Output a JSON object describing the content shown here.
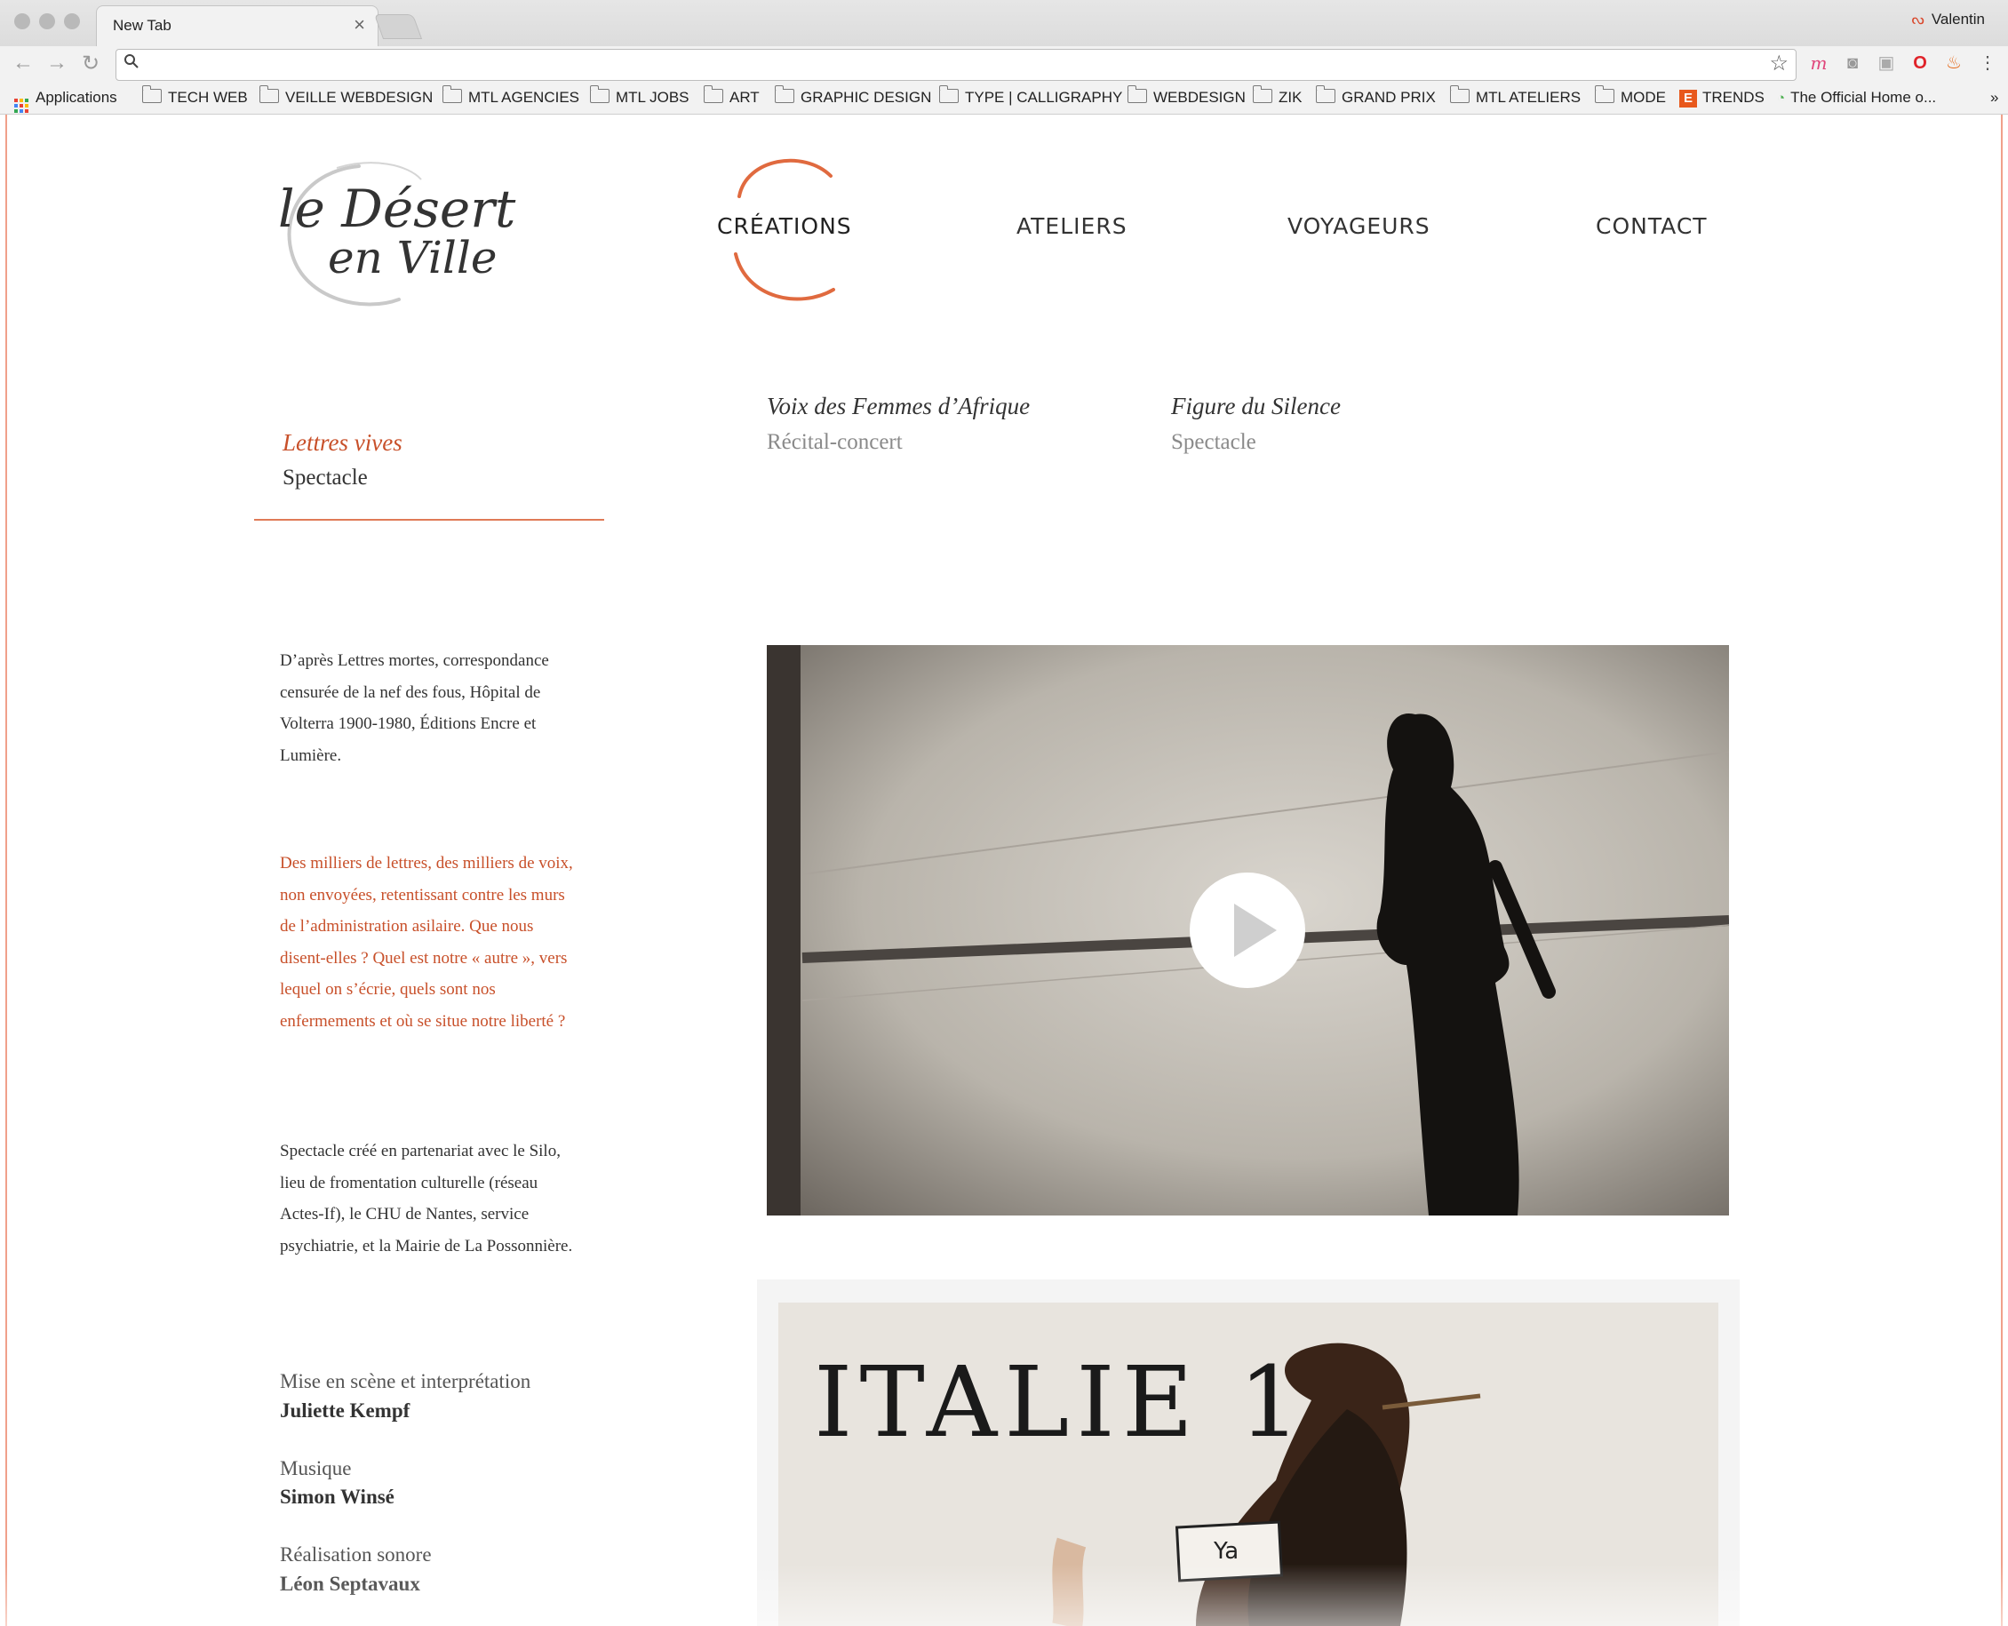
{
  "browser": {
    "tab_title": "New Tab",
    "tab_close": "×",
    "profile_name": "Valentin",
    "address_value": "",
    "bookmarks": [
      "Applications",
      "TECH WEB",
      "VEILLE WEBDESIGN",
      "MTL AGENCIES",
      "MTL JOBS",
      "ART",
      "GRAPHIC DESIGN",
      "TYPE | CALLIGRAPHY",
      "WEBDESIGN",
      "ZIK",
      "GRAND PRIX",
      "MTL ATELIERS",
      "MODE",
      "TRENDS",
      "The Official Home o..."
    ],
    "bookmarks_overflow": "»",
    "icons": [
      "back-arrow-icon",
      "forward-arrow-icon",
      "reload-icon",
      "search-icon",
      "star-icon",
      "extension-icons",
      "menu-icon"
    ]
  },
  "site": {
    "logo_line1": "le Désert",
    "logo_line2": "en Ville",
    "nav": [
      "CRÉATIONS",
      "ATELIERS",
      "VOYAGEURS",
      "CONTACT"
    ],
    "nav_active": "CRÉATIONS",
    "accent_color": "#c8502a"
  },
  "subnav": [
    {
      "title": "Lettres vives",
      "kind": "Spectacle",
      "active": true
    },
    {
      "title": "Voix des Femmes d’Afrique",
      "kind": "Récital-concert",
      "active": false
    },
    {
      "title": "Figure du Silence",
      "kind": "Spectacle",
      "active": false
    }
  ],
  "content": {
    "intro": "D’après Lettres mortes, correspondance censurée de la nef des fous, Hôpital de Volterra 1900-1980, Éditions Encre et Lumière.",
    "quote": "Des milliers de lettres, des milliers de voix, non envoyées, retentissant contre les murs de l’administration asilaire. Que nous disent-elles ? Quel est notre « autre », vers lequel on s’écrie, quels sont nos enfermements et où se situe notre liberté ?",
    "partners": "Spectacle créé en partenariat avec le Silo, lieu de fromentation culturelle (réseau Actes-If), le CHU de Nantes, service psychiatrie, et la Mairie de La Possonnière.",
    "credits": [
      {
        "role": "Mise en scène et interprétation",
        "name": "Juliette Kempf"
      },
      {
        "role": "Musique",
        "name": "Simon Winsé"
      },
      {
        "role": "Réalisation sonore",
        "name": "Léon Septavaux"
      }
    ],
    "photo_text": "ITALIE 19",
    "photo_stamp": "Ya"
  }
}
